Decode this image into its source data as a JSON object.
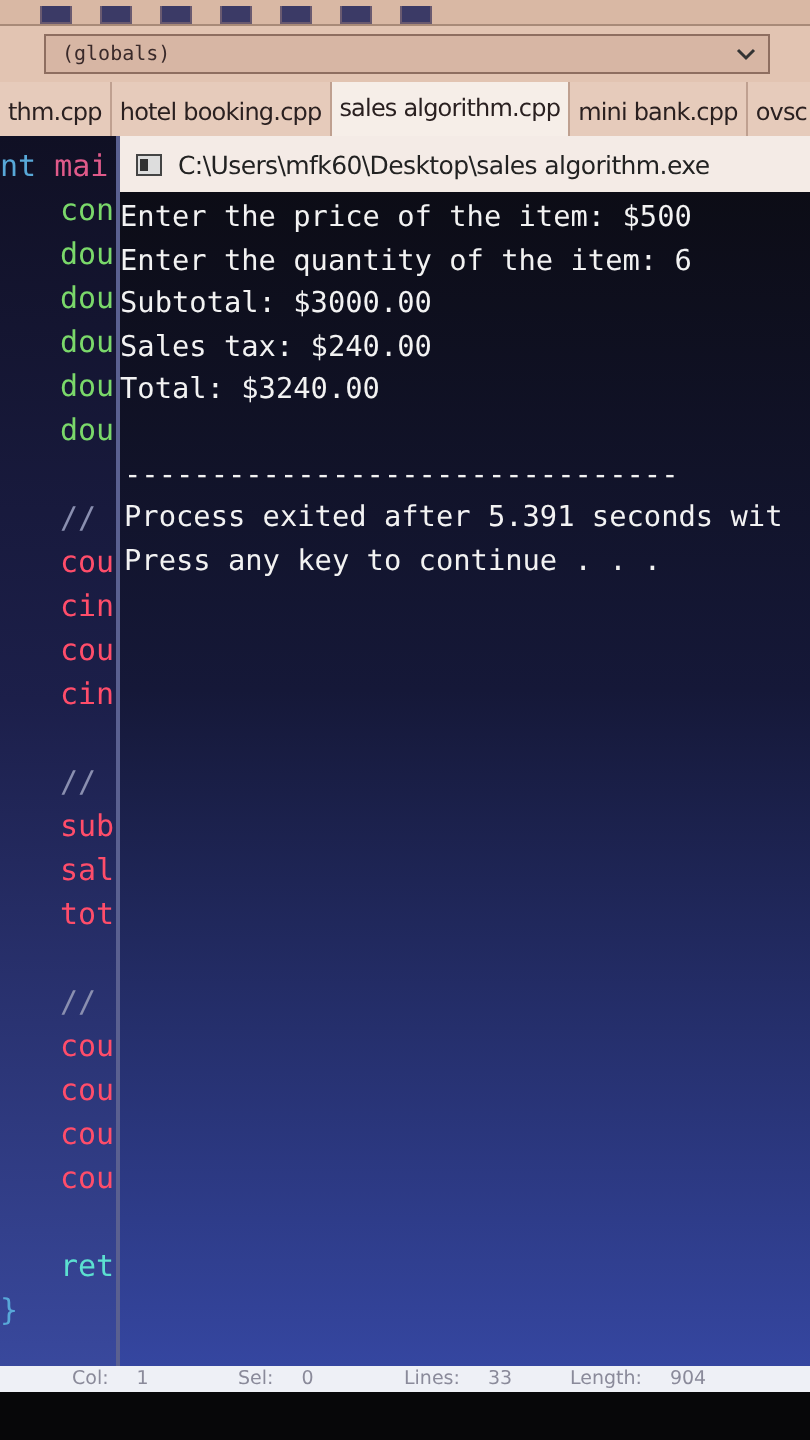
{
  "scope_selector": {
    "value": "(globals)"
  },
  "tabs": [
    {
      "label": "thm.cpp",
      "selected": false
    },
    {
      "label": "hotel booking.cpp",
      "selected": false
    },
    {
      "label": "sales algorithm.cpp",
      "selected": true
    },
    {
      "label": "mini bank.cpp",
      "selected": false
    },
    {
      "label": "ovsc",
      "selected": false
    }
  ],
  "editor_lines": [
    {
      "gap_before": false,
      "tokens": [
        {
          "text": "nt",
          "kind": "plain"
        },
        {
          "text": " mai",
          "kind": "call"
        }
      ]
    },
    {
      "gap_before": false,
      "tokens": [
        {
          "text": "con",
          "kind": "type"
        }
      ]
    },
    {
      "gap_before": false,
      "tokens": [
        {
          "text": "dou",
          "kind": "type"
        }
      ]
    },
    {
      "gap_before": false,
      "tokens": [
        {
          "text": "dou",
          "kind": "type"
        }
      ]
    },
    {
      "gap_before": false,
      "tokens": [
        {
          "text": "dou",
          "kind": "type"
        }
      ]
    },
    {
      "gap_before": false,
      "tokens": [
        {
          "text": "dou",
          "kind": "type"
        }
      ]
    },
    {
      "gap_before": false,
      "tokens": [
        {
          "text": "dou",
          "kind": "type"
        }
      ]
    },
    {
      "gap_before": true,
      "tokens": [
        {
          "text": "//",
          "kind": "comment"
        }
      ]
    },
    {
      "gap_before": false,
      "tokens": [
        {
          "text": "cou",
          "kind": "io"
        }
      ]
    },
    {
      "gap_before": false,
      "tokens": [
        {
          "text": "cin",
          "kind": "io"
        }
      ]
    },
    {
      "gap_before": false,
      "tokens": [
        {
          "text": "cou",
          "kind": "io"
        }
      ]
    },
    {
      "gap_before": false,
      "tokens": [
        {
          "text": "cin",
          "kind": "io"
        }
      ]
    },
    {
      "gap_before": true,
      "tokens": [
        {
          "text": "//",
          "kind": "comment"
        }
      ]
    },
    {
      "gap_before": false,
      "tokens": [
        {
          "text": "sub",
          "kind": "io"
        }
      ]
    },
    {
      "gap_before": false,
      "tokens": [
        {
          "text": "sal",
          "kind": "io"
        }
      ]
    },
    {
      "gap_before": false,
      "tokens": [
        {
          "text": "tot",
          "kind": "io"
        }
      ]
    },
    {
      "gap_before": true,
      "tokens": [
        {
          "text": "//",
          "kind": "comment"
        }
      ]
    },
    {
      "gap_before": false,
      "tokens": [
        {
          "text": "cou",
          "kind": "io"
        }
      ]
    },
    {
      "gap_before": false,
      "tokens": [
        {
          "text": "cou",
          "kind": "io"
        }
      ]
    },
    {
      "gap_before": false,
      "tokens": [
        {
          "text": "cou",
          "kind": "io"
        }
      ]
    },
    {
      "gap_before": false,
      "tokens": [
        {
          "text": "cou",
          "kind": "io"
        }
      ]
    },
    {
      "gap_before": true,
      "tokens": [
        {
          "text": "ret",
          "kind": "return"
        }
      ]
    },
    {
      "gap_before": false,
      "tokens": [
        {
          "text": "}",
          "kind": "plain"
        }
      ]
    }
  ],
  "console": {
    "title": "C:\\Users\\mfk60\\Desktop\\sales algorithm.exe",
    "output_lines": [
      "Enter the price of the item: $500",
      "Enter the quantity of the item: 6",
      "Subtotal: $3000.00",
      "Sales tax: $240.00",
      "Total: $3240.00"
    ],
    "separator": "--------------------------------",
    "footer_lines": [
      "Process exited after 5.391 seconds wit",
      "Press any key to continue . . ."
    ]
  },
  "status_bar": [
    {
      "label": "Col:",
      "value": "1"
    },
    {
      "label": "Sel:",
      "value": "0"
    },
    {
      "label": "Lines:",
      "value": "33"
    },
    {
      "label": "Length:",
      "value": "904"
    }
  ]
}
